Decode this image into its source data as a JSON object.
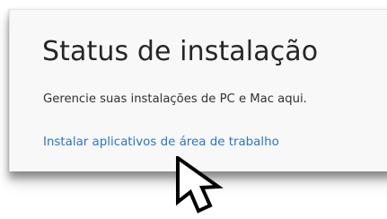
{
  "install_status": {
    "title": "Status de instalação",
    "description": "Gerencie suas instalações de PC e Mac aqui.",
    "install_link_label": "Instalar aplicativos de área de trabalho"
  },
  "colors": {
    "link": "#2b74c6",
    "card_background": "#f8f8f8",
    "title_text": "#262626"
  },
  "icons": {
    "cursor": "arrow-cursor-icon"
  }
}
